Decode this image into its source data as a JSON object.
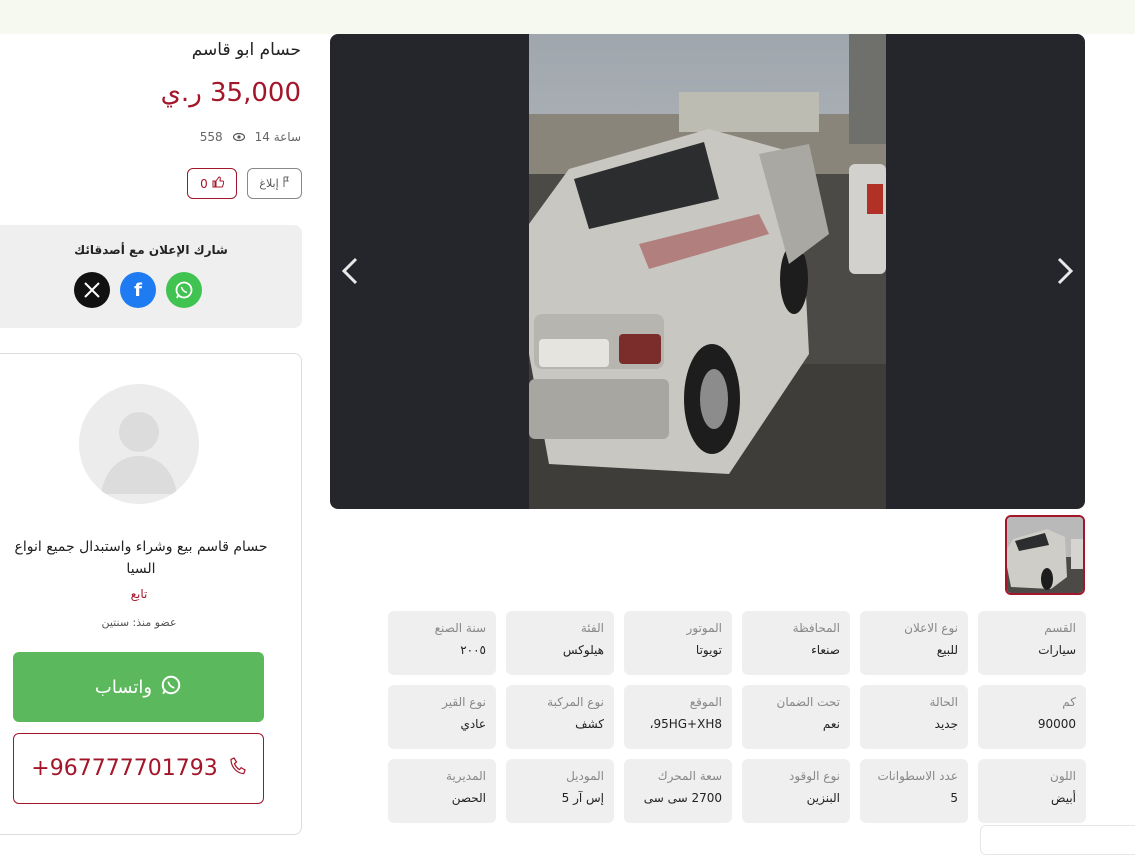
{
  "ad": {
    "title": "حسام ابو قاسم",
    "price": "35,000 ر.ي",
    "time_ago": "14 ساعة",
    "views": "558",
    "likes": "0",
    "report_label": "إبلاغ"
  },
  "share": {
    "title": "شارك الإعلان مع أصدقائك",
    "networks": [
      "x-icon",
      "facebook-icon",
      "whatsapp-icon"
    ]
  },
  "seller": {
    "name": "حسام قاسم بيع وشراء واستبدال جميع انواع السيا",
    "follow_label": "تابع",
    "member_since": "عضو منذ: سنتين",
    "whatsapp_label": "واتساب",
    "phone": "+967777701793"
  },
  "gallery": {
    "prev_icon": "chevron-left-icon",
    "next_icon": "chevron-right-icon"
  },
  "specs": [
    {
      "label": "القسم",
      "value": "سيارات"
    },
    {
      "label": "نوع الاعلان",
      "value": "للبيع"
    },
    {
      "label": "المحافظة",
      "value": "صنعاء"
    },
    {
      "label": "الموتور",
      "value": "تويوتا"
    },
    {
      "label": "الفئة",
      "value": "هيلوكس"
    },
    {
      "label": "سنة الصنع",
      "value": "٢٠٠٥"
    },
    {
      "label": "كم",
      "value": "90000"
    },
    {
      "label": "الحالة",
      "value": "جديد"
    },
    {
      "label": "تحت الضمان",
      "value": "نعم"
    },
    {
      "label": "الموقع",
      "value": "95HG+XH8،"
    },
    {
      "label": "نوع المركبة",
      "value": "كشف"
    },
    {
      "label": "نوع القير",
      "value": "عادي"
    },
    {
      "label": "اللون",
      "value": "أبيض"
    },
    {
      "label": "عدد الاسطوانات",
      "value": "5"
    },
    {
      "label": "نوع الوقود",
      "value": "البنزين"
    },
    {
      "label": "سعة المحرك",
      "value": "2700 سی سی"
    },
    {
      "label": "الموديل",
      "value": "إس آر 5"
    },
    {
      "label": "المديرية",
      "value": "الحصن"
    }
  ],
  "colors": {
    "accent": "#a3162a",
    "whatsapp": "#5cb85c",
    "gallery_bg": "#24262b",
    "card_bg": "#efefef"
  }
}
